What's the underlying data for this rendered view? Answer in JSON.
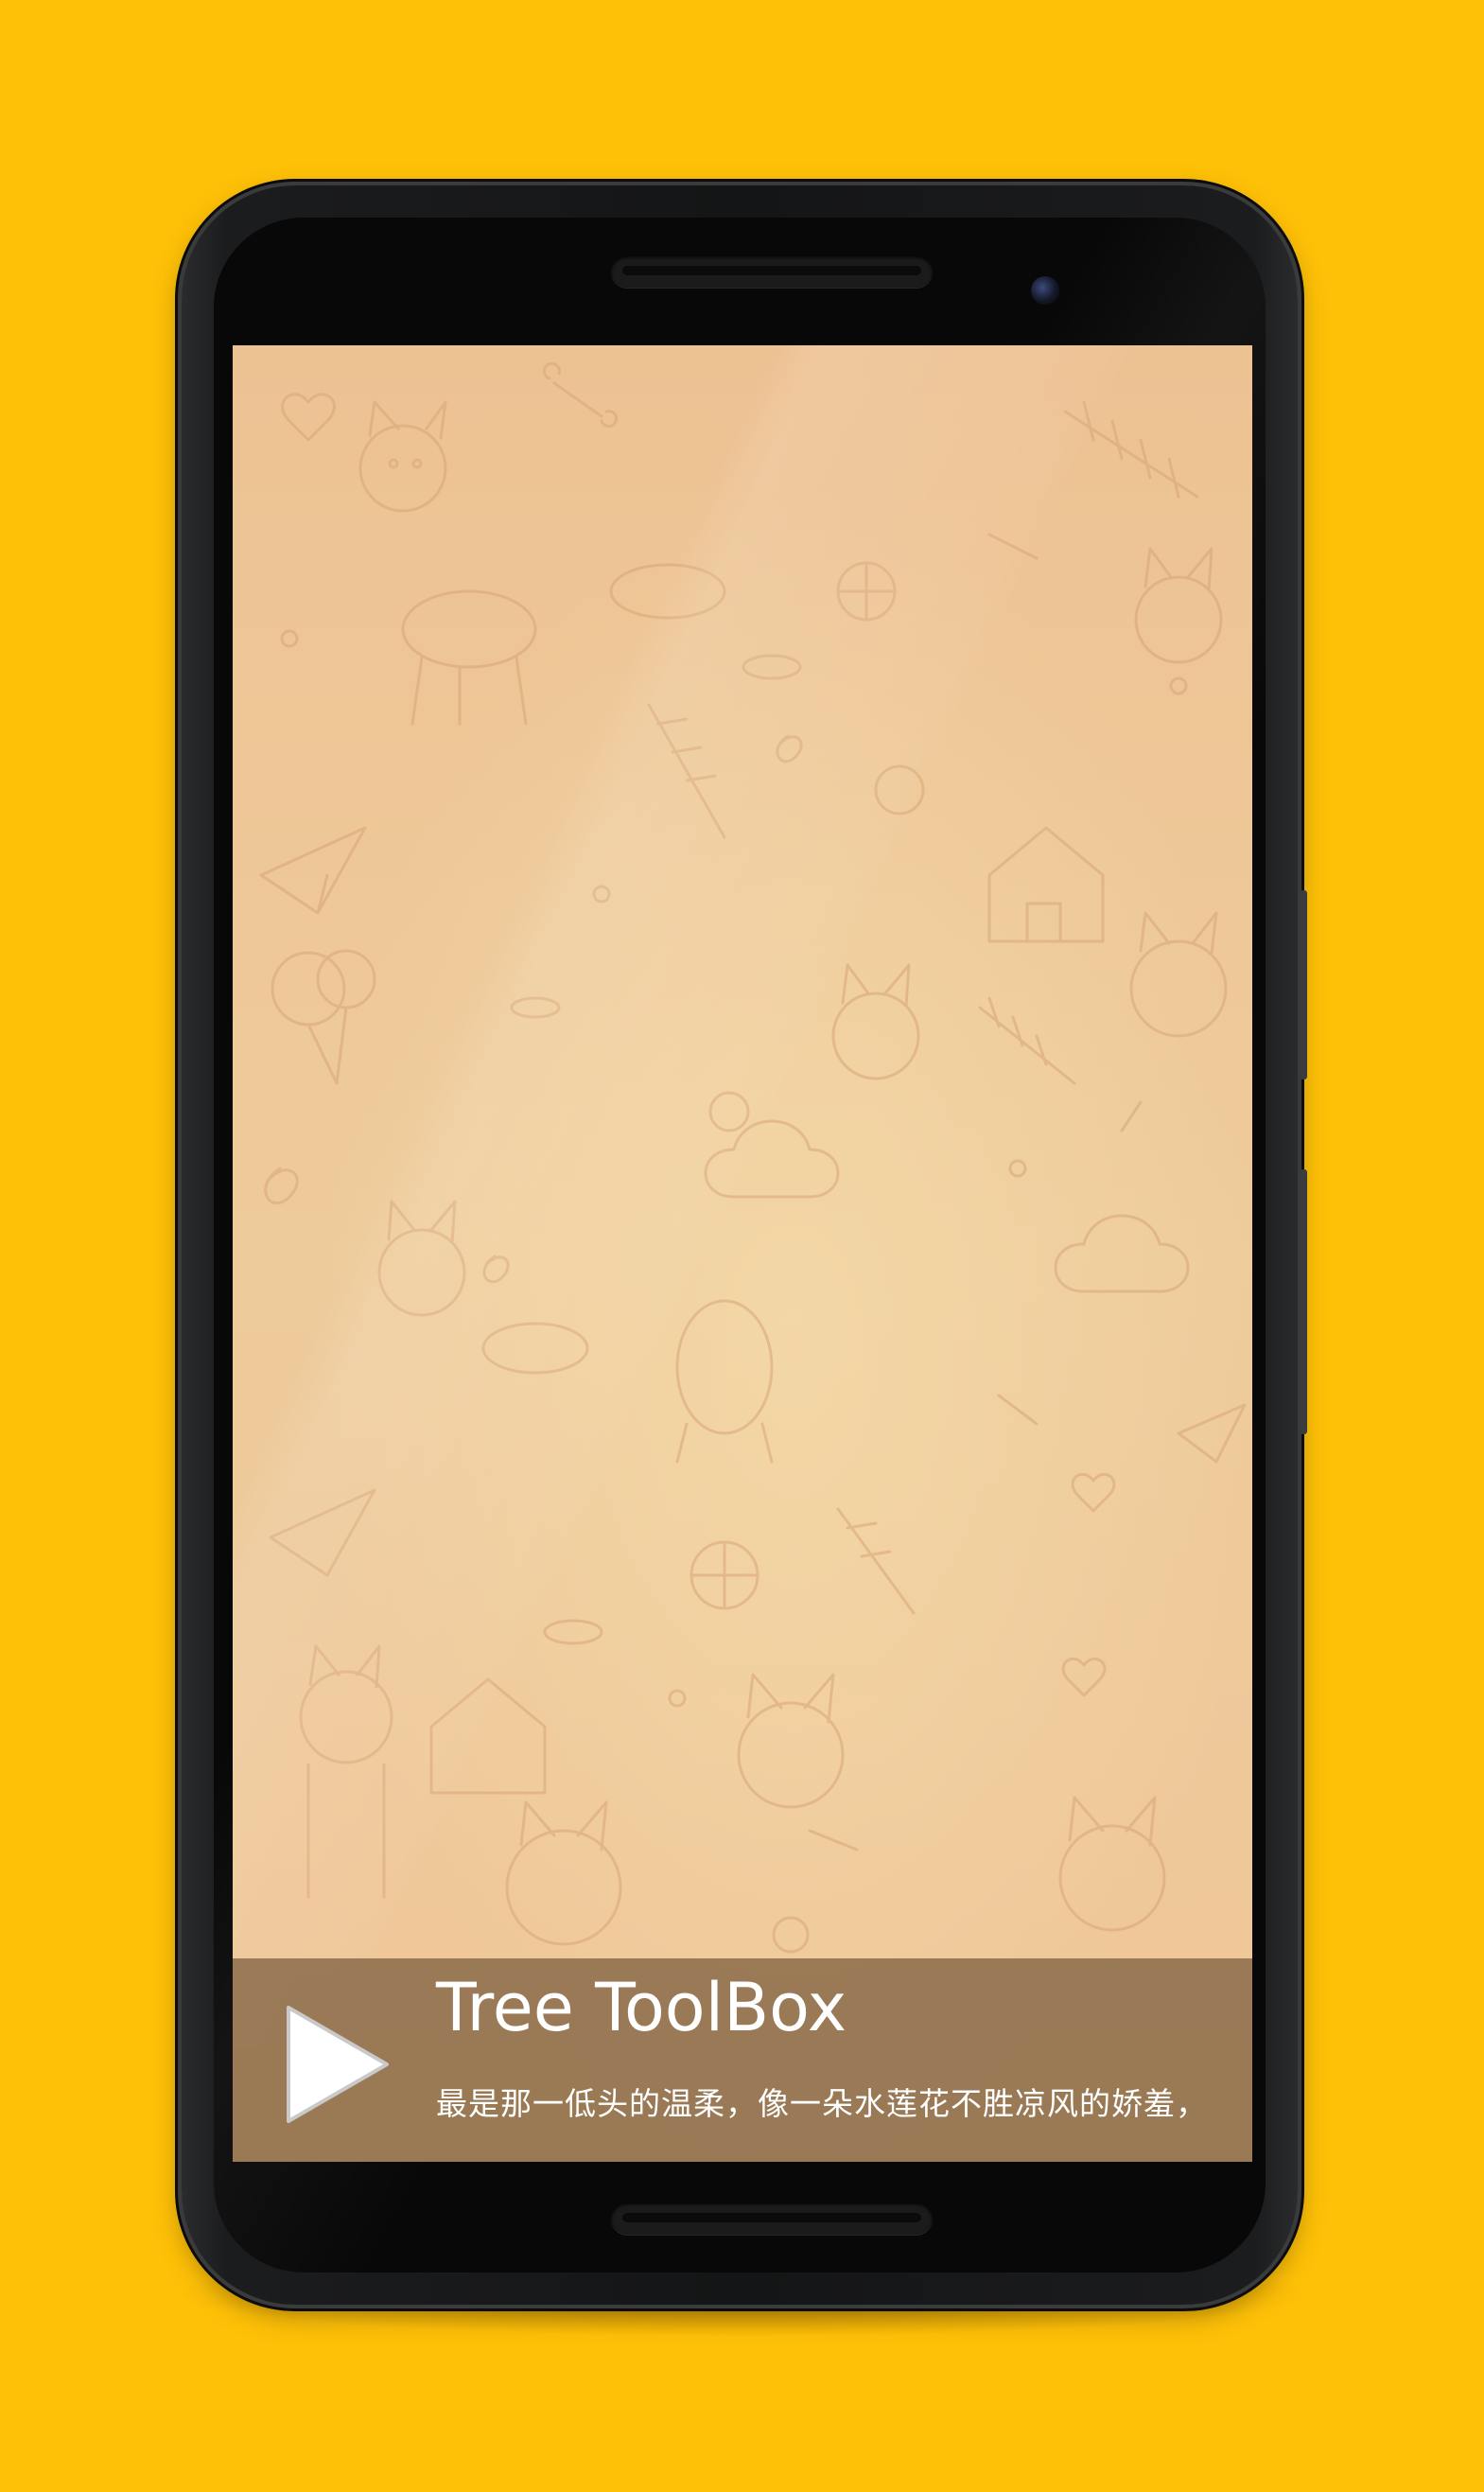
{
  "colors": {
    "background": "#FFC107",
    "screen_wallpaper": "#EFC99A",
    "player_bar": "#785C3C"
  },
  "player": {
    "title": "Tree ToolBox",
    "subtitle": "最是那一低头的温柔，像一朵水莲花不胜凉风的娇羞，",
    "play_icon": "play-icon"
  }
}
